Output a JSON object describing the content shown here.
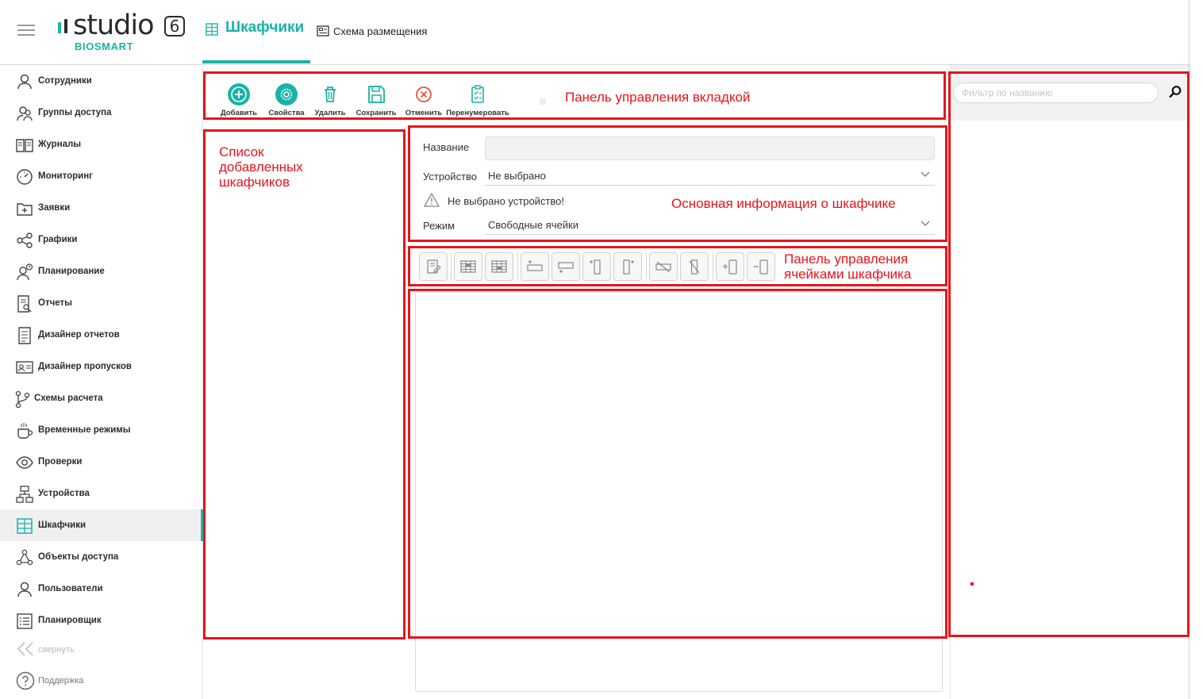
{
  "header": {
    "logo_word": "studio",
    "logo_version": "6",
    "logo_brand": "BIOSMART",
    "tabs": [
      {
        "label": "Шкафчики",
        "icon": "locker-grid-icon",
        "active": true
      },
      {
        "label": "Схема размещения",
        "icon": "layout-scheme-icon",
        "active": false
      }
    ]
  },
  "sidebar": {
    "items": [
      {
        "label": "Сотрудники",
        "icon": "person-icon"
      },
      {
        "label": "Группы доступа",
        "icon": "people-group-icon"
      },
      {
        "label": "Журналы",
        "icon": "book-icon"
      },
      {
        "label": "Мониторинг",
        "icon": "gauge-icon"
      },
      {
        "label": "Заявки",
        "icon": "folder-plus-icon"
      },
      {
        "label": "Графики",
        "icon": "share-nodes-icon"
      },
      {
        "label": "Планирование",
        "icon": "person-clock-icon"
      },
      {
        "label": "Отчеты",
        "icon": "report-search-icon"
      },
      {
        "label": "Дизайнер отчетов",
        "icon": "report-designer-icon"
      },
      {
        "label": "Дизайнер пропусков",
        "icon": "id-card-icon"
      },
      {
        "label": "Схемы расчета",
        "icon": "branch-icon"
      },
      {
        "label": "Временные режимы",
        "icon": "cup-icon"
      },
      {
        "label": "Проверки",
        "icon": "eye-icon"
      },
      {
        "label": "Устройства",
        "icon": "network-icon"
      },
      {
        "label": "Шкафчики",
        "icon": "locker-grid-icon",
        "active": true
      },
      {
        "label": "Объекты доступа",
        "icon": "nodes-icon"
      },
      {
        "label": "Пользователи",
        "icon": "user-icon"
      },
      {
        "label": "Планировщик",
        "icon": "list-icon"
      }
    ],
    "collapse_label": "свернуть",
    "support_label": "Поддержка"
  },
  "toolbar": {
    "buttons": [
      {
        "label": "Добавить",
        "icon": "plus-circle-icon"
      },
      {
        "label": "Свойства",
        "icon": "gear-circle-icon"
      },
      {
        "label": "Удалить",
        "icon": "trash-icon"
      },
      {
        "label": "Сохранить",
        "icon": "save-icon"
      },
      {
        "label": "Отменить",
        "icon": "cancel-circle-icon"
      },
      {
        "label": "Перенумеровать",
        "icon": "clipboard-check-icon"
      }
    ]
  },
  "form": {
    "name_label": "Название",
    "name_value": "",
    "device_label": "Устройство",
    "device_value": "Не выбрано",
    "warning_text": "Не выбрано устройство!",
    "mode_label": "Режим",
    "mode_value": "Свободные ячейки"
  },
  "cell_toolbar": {
    "buttons": [
      {
        "icon": "edit-cell-icon"
      },
      {
        "icon": "grid-select-top-icon"
      },
      {
        "icon": "grid-select-bottom-icon"
      },
      {
        "icon": "insert-row-above-icon"
      },
      {
        "icon": "insert-row-below-icon"
      },
      {
        "icon": "insert-column-left-icon"
      },
      {
        "icon": "insert-column-right-icon"
      },
      {
        "icon": "delete-row-icon"
      },
      {
        "icon": "delete-column-icon"
      },
      {
        "icon": "add-cell-icon"
      },
      {
        "icon": "remove-cell-icon"
      }
    ]
  },
  "right_panel": {
    "filter_placeholder": "Фильтр по названию",
    "search_icon": "search-icon"
  },
  "annotations": {
    "tab_panel": "Панель управления вкладкой",
    "locker_list_line1": "Список",
    "locker_list_line2": "добавленных",
    "locker_list_line3": "шкафчиков",
    "main_info": "Основная информация о шкафчике",
    "cell_panel_line1": "Панель управления",
    "cell_panel_line2": "ячейками шкафчика",
    "color": "#e8141c"
  },
  "colors": {
    "accent": "#19b3a6",
    "annotation": "#e8141c",
    "active_nav_bg": "#f0f0f0"
  }
}
